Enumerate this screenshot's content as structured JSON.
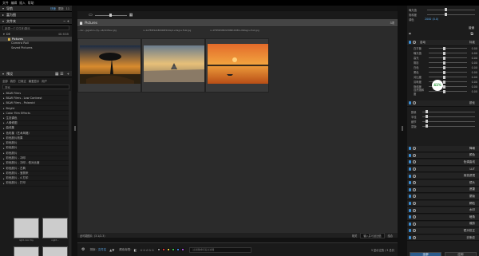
{
  "menu": [
    "文件",
    "编辑",
    "插入",
    "帮助"
  ],
  "left": {
    "nav_title": "导航",
    "tab_quick": "快速",
    "tab_more": "更新",
    "tab_extra": "11",
    "history_title": "富为图",
    "folders_title": "文件夹",
    "root_label": "新建一个文件夹/路径",
    "drive": "DE",
    "drive_size": "48.6GB",
    "pictures": "Pictures",
    "camera_roll": "Camera Roll",
    "saved_pictures": "Saved Pictures",
    "presets_title": "预设",
    "tabs": [
      "全部",
      "我的",
      "已用过",
      "最爱显示",
      "用户"
    ],
    "search_placeholder": "搜索",
    "presets": [
      "B&W Films",
      "B&W Films - Low Contrast",
      "B&W Films - Polaroid",
      "Bright",
      "Color Film Effects",
      "生态调色",
      "人像修图",
      "曲线集",
      "色彩集（艺术风格）",
      "彩色胶片效果",
      "彩色胶片",
      "彩色胶片",
      "彩色胶片",
      "彩色胶片 - 冲印",
      "彩色胶片 - 冲印 - 低对比度",
      "彩色胶片 - 古典",
      "彩色胶片 - 宝丽来",
      "彩色胶片 - 4 打印",
      "彩色胶片 - 打印"
    ],
    "thumb_label_a": "light color toy",
    "thumb_label_b": "night..."
  },
  "center": {
    "path": "Pictures",
    "count": "3项",
    "filenames": [
      "....dsc...jpg/ehm+/3y...alt/v0.Musc.jpg",
      "c+1A7E0E1A1B0900E014xp1+Dagn+Fuzz.jpg",
      "c+1F5E0958E2238881D1B0+06dagn+Fuzz.jpg"
    ],
    "status_left": "此可能图片（3.1/2.3）",
    "status_right": "相关",
    "status_input": "输入并可返回值",
    "status_end": "结合",
    "sort_label": "排序:",
    "sort_value": "文件名",
    "color_label": "颜色标签:",
    "filter_placeholder": "过滤器或标签过滤器",
    "count_right": "3 显示过的 / 3 总共"
  },
  "right": {
    "top_labels": [
      "曝光值",
      "饱和度",
      "调色",
      "色温"
    ],
    "top_value": "2000 (0.0)",
    "camera_label": "普通",
    "profile": "标准",
    "auto": "自动",
    "section": "曝光",
    "sliders": [
      "白平衡",
      "曝光值",
      "高光",
      "阴影",
      "白色",
      "黑色",
      "对比度",
      "清晰度",
      "饱和度",
      "自然饱和度"
    ],
    "slider_values": [
      "0.00",
      "0.00",
      "0.00",
      "0.00",
      "0.00",
      "0.00",
      "0.00",
      "0.00",
      "0.00",
      "0.00"
    ],
    "histogram_value": "41%",
    "sharpen_label": "锐化",
    "sharpen_sliders": [
      "数量",
      "半径",
      "细节",
      "蒙版"
    ],
    "modules": [
      "降噪",
      "颜色",
      "色调曲线",
      "LUT",
      "渐变滤镜",
      "镜头",
      "遮罩",
      "蒙版",
      "颗粒",
      "水印",
      "暗角",
      "裁剪",
      "镜头校正",
      "去条纹"
    ],
    "btn_all": "全部",
    "btn_apply": "应用"
  }
}
